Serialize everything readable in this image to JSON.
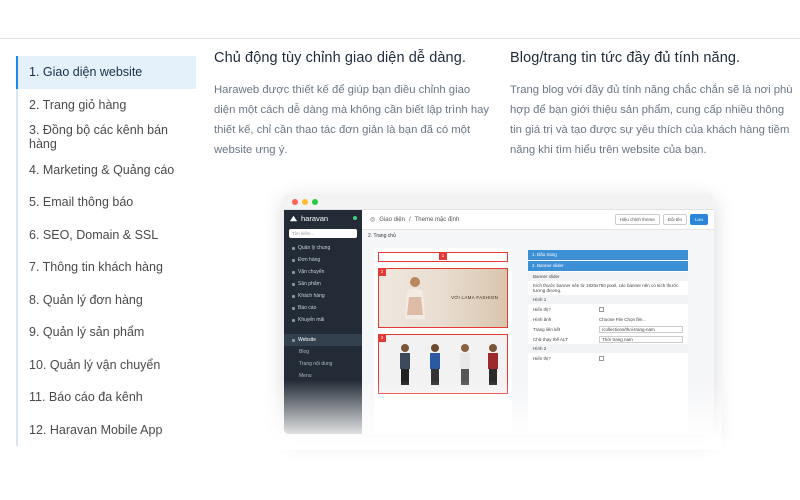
{
  "menu": {
    "items": [
      {
        "label": "1. Giao diện website"
      },
      {
        "label": "2.  Trang giỏ hàng"
      },
      {
        "label": "3.  Đồng bộ các kênh bán hàng"
      },
      {
        "label": "4.  Marketing & Quảng cáo"
      },
      {
        "label": "5.  Email thông báo"
      },
      {
        "label": "6.  SEO, Domain & SSL"
      },
      {
        "label": "7.  Thông tin khách hàng"
      },
      {
        "label": "8.  Quản lý đơn hàng"
      },
      {
        "label": "9.  Quản lý sản phẩm"
      },
      {
        "label": "10.  Quản lý vận chuyển"
      },
      {
        "label": "11.  Báo cáo đa kênh"
      },
      {
        "label": "12.  Haravan Mobile App"
      }
    ],
    "active_index": 0
  },
  "features": [
    {
      "title": "Chủ động tùy chỉnh giao diện dễ dàng.",
      "body": "Haraweb được thiết kế để giúp bạn điều chỉnh giao diện một cách dễ dàng mà không cần biết lập trình hay thiết kế, chỉ cần thao tác đơn giản là bạn đã có một website ưng ý."
    },
    {
      "title": "Blog/trang tin tức đầy đủ tính năng.",
      "body": "Trang blog với đầy đủ tính năng chắc chắn sẽ là nơi phù hợp để bạn giới thiệu sản phẩm, cung cấp nhiều thông tin giá trị và tạo được sự yêu thích của khách hàng tiềm năng khi tìm hiểu trên website của bạn."
    }
  ],
  "preview": {
    "logo": "haravan",
    "search_placeholder": "Tìm kiếm...",
    "nav": [
      "Quản lý chung",
      "Đơn hàng",
      "Vận chuyển",
      "Sản phẩm",
      "Khách hàng",
      "Báo cáo",
      "Khuyến mãi"
    ],
    "website_label": "Website",
    "website_sub": [
      "Blog",
      "Trang nội dung",
      "Menu"
    ],
    "breadcrumb_parent": "Giao diện",
    "breadcrumb_current": "Theme mặc định",
    "btn_preview": "Hiệu chỉnh theme",
    "btn_change": "Đổi tên",
    "btn_save": "Lưu",
    "section_title": "2. Trang chủ",
    "banner_text": "VỚI LAMA FASHION",
    "panel": {
      "h1": "1. Đầu trang",
      "h2": "2. Banner slider",
      "sub": "Banner slider",
      "desc": "Kích thước banner nên từ 1920x750 pixel, các banner nên có kích thước tương đương.",
      "img1": "Hình 1",
      "show": "Hiển thị?",
      "image": "Hình ảnh",
      "file": "Choose File   Chọn file...",
      "link": "Trang liên kết",
      "link_val": "/collections/thoi-trang-nam",
      "alt": "Chữ thay thế ALT",
      "alt_val": "Thời trang nam",
      "img2": "Hình 2",
      "show2": "Hiển thị?"
    },
    "colors": {
      "red": "#ff5f57",
      "yellow": "#febc2e",
      "green": "#28c840"
    }
  }
}
